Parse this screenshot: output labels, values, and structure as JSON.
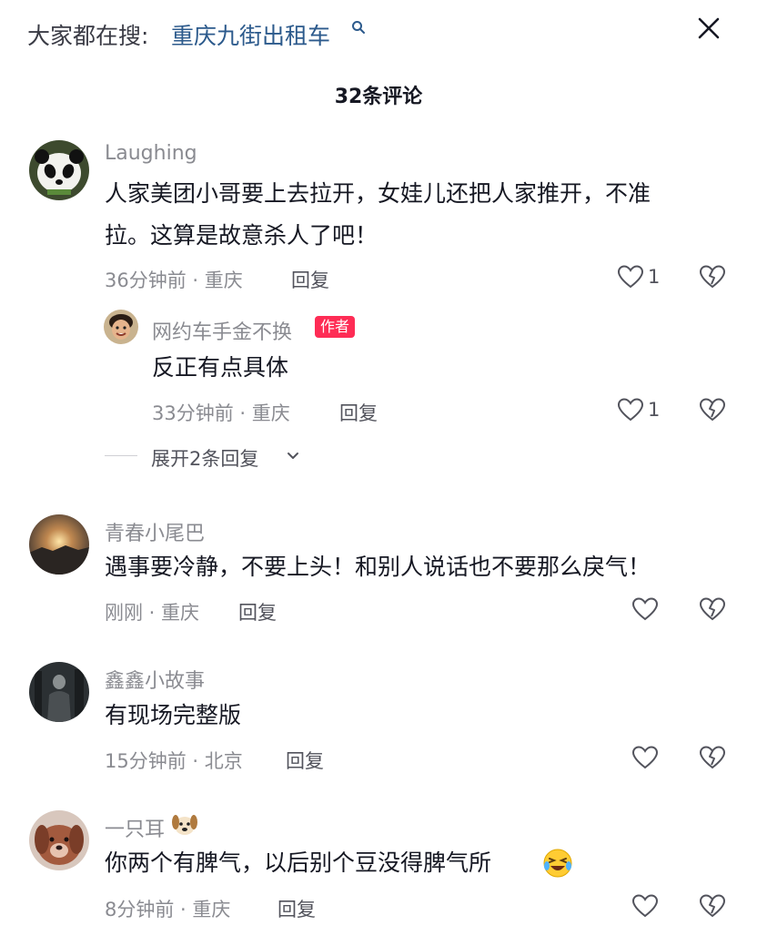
{
  "header": {
    "search_prefix": "大家都在搜:",
    "search_term": "重庆九街出租车"
  },
  "comment_count": "32条评论",
  "comments": [
    {
      "username": "Laughing",
      "text_line1": "人家美团小哥要上去拉开，女娃儿还把人家推开，不准",
      "text_line2": "拉。这算是故意杀人了吧！",
      "meta": "36分钟前 · 重庆",
      "reply": "回复",
      "likes": "1",
      "reply_item": {
        "username": "网约车手金不换",
        "badge": "作者",
        "text": "反正有点具体",
        "meta": "33分钟前 · 重庆",
        "reply": "回复",
        "likes": "1"
      },
      "expand": "展开2条回复"
    },
    {
      "username": "青春小尾巴",
      "text": "遇事要冷静，不要上头！和别人说话也不要那么戾气！",
      "meta": "刚刚 · 重庆",
      "reply": "回复"
    },
    {
      "username": "鑫鑫小故事",
      "text": "有现场完整版",
      "meta": "15分钟前 · 北京",
      "reply": "回复"
    },
    {
      "username": "一只耳",
      "text": "你两个有脾气，以后别个豆没得脾气所",
      "meta": "8分钟前 · 重庆",
      "reply": "回复"
    }
  ],
  "icons": {
    "search": "search-icon",
    "close": "close-icon",
    "like": "heart-outline-icon",
    "dislike": "broken-heart-icon",
    "dog_emoji": "dog-face-icon",
    "laughing_emoji": "rofl-emoji-icon"
  },
  "colors": {
    "search_term": "#2c5a8c",
    "author_badge": "#fe2c55",
    "secondary_text": "#8a8b91"
  }
}
